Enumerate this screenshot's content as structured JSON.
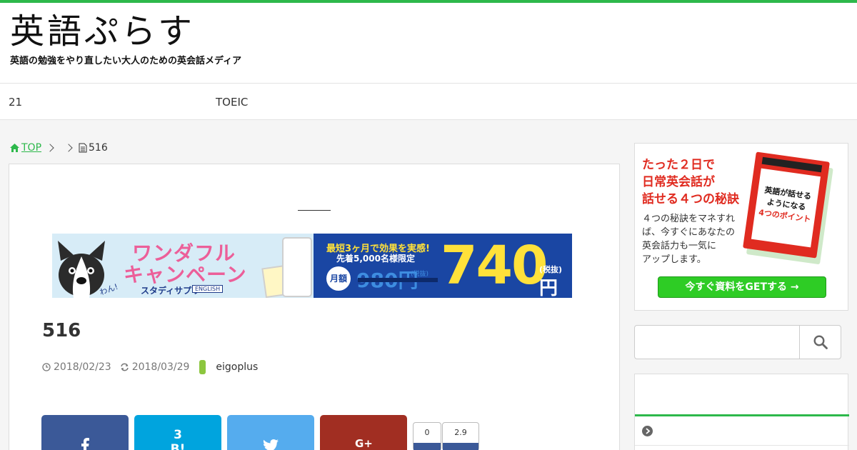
{
  "header": {
    "logo_text": "英語ぷらす",
    "tagline": "英語の勉強をやり直したい大人のための英会話メディア"
  },
  "nav": {
    "items": [
      {
        "label": "21"
      },
      {
        "label": "TOEIC"
      }
    ]
  },
  "breadcrumb": {
    "home": "TOP",
    "current": "516"
  },
  "banner": {
    "campaign_line1": "ワンダフル",
    "campaign_line2": "キャンペーン",
    "brand": "スタディサプリ",
    "brand_en": "ENGLISH",
    "mascot_text": "わん!",
    "promo_line1": "最短3ヶ月で効果を実感!",
    "promo_line2": "先着5,000名様限定",
    "monthly": "月額",
    "old_price": "980円",
    "old_tax": "(税抜)",
    "new_price": "740",
    "new_tax": "(税抜)",
    "yen": "円"
  },
  "post": {
    "title": "516",
    "published": "2018/02/23",
    "updated": "2018/03/29",
    "author": "eigoplus"
  },
  "share": {
    "hatena_count": "3",
    "hatena_label": "B!",
    "count_left": "0",
    "count_right": "2.9"
  },
  "sidebar": {
    "ad": {
      "lead_line1": "たった２日で",
      "lead_line2": "日常英会話が",
      "lead_line3": "話せる４つの秘訣",
      "body_line1": "４つの秘訣をマネすれ",
      "body_line2": "ば、今すぐにあなたの",
      "body_line3": "英会話力も一気に",
      "body_line4": "アップします。",
      "book_line1": "英語が話せる",
      "book_line2": "ようになる",
      "book_line3": "4つのポイント",
      "button": "今すぐ資料をGETする →"
    },
    "search": {
      "placeholder": ""
    }
  },
  "colors": {
    "accent": "#2db84b",
    "facebook": "#3b5998",
    "hatena": "#00a4de",
    "twitter": "#55acee",
    "googleplus": "#a12e22"
  }
}
